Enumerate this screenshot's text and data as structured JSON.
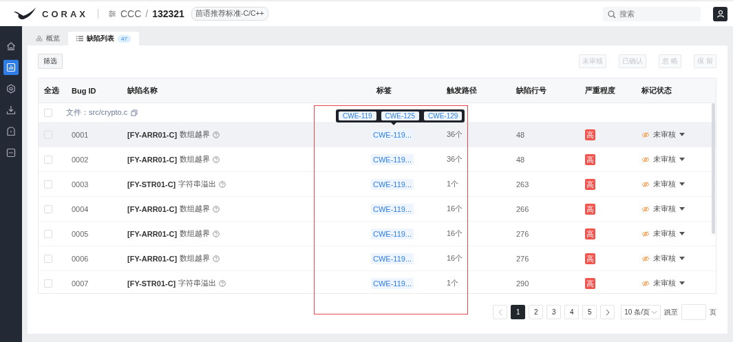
{
  "header": {
    "logo": "CORAX",
    "project": "CCC",
    "separator": "/",
    "id": "132321",
    "standard": "茴语推荐标准-C/C++",
    "search": {
      "placeholder": "搜索"
    }
  },
  "sidebar": {
    "items": [
      {
        "kind": "home",
        "selected": false
      },
      {
        "kind": "chart",
        "selected": true
      },
      {
        "kind": "target",
        "selected": false
      },
      {
        "kind": "download",
        "selected": false
      },
      {
        "kind": "shield",
        "selected": false
      },
      {
        "kind": "bug",
        "selected": false
      }
    ]
  },
  "tabs": [
    {
      "label": "概览",
      "selected": false
    },
    {
      "label": "缺陷列表",
      "count": "47",
      "selected": true
    }
  ],
  "filter_button": "筛选",
  "actions": [
    {
      "label": "未审核",
      "disabled": true
    },
    {
      "label": "已确认",
      "disabled": true
    },
    {
      "label": "忽 略",
      "disabled": true
    },
    {
      "label": "保 留",
      "disabled": true
    }
  ],
  "table": {
    "columns": [
      "全选",
      "Bug ID",
      "缺陷名称",
      "标签",
      "触发路径",
      "缺陷行号",
      "严重程度",
      "标记状态"
    ],
    "file_group": {
      "label": "文件：src/crypto.c",
      "checked": false
    },
    "rows": [
      {
        "id": "0001",
        "rule": "[FY-ARR01-C]",
        "name": "数组越界",
        "tag": "CWE-119...",
        "paths": "36个",
        "line": "48",
        "severity": "高",
        "status": "未审核",
        "checked": false,
        "highlighted": true
      },
      {
        "id": "0002",
        "rule": "[FY-ARR01-C]",
        "name": "数组越界",
        "tag": "CWE-119...",
        "paths": "36个",
        "line": "48",
        "severity": "高",
        "status": "未审核",
        "checked": false,
        "highlighted": false
      },
      {
        "id": "0003",
        "rule": "[FY-STR01-C]",
        "name": "字符串溢出",
        "tag": "CWE-119...",
        "paths": "1个",
        "line": "263",
        "severity": "高",
        "status": "未审核",
        "checked": false,
        "highlighted": false
      },
      {
        "id": "0004",
        "rule": "[FY-ARR01-C]",
        "name": "数组越界",
        "tag": "CWE-119...",
        "paths": "16个",
        "line": "266",
        "severity": "高",
        "status": "未审核",
        "checked": false,
        "highlighted": false
      },
      {
        "id": "0005",
        "rule": "[FY-ARR01-C]",
        "name": "数组越界",
        "tag": "CWE-119...",
        "paths": "16个",
        "line": "276",
        "severity": "高",
        "status": "未审核",
        "checked": false,
        "highlighted": false
      },
      {
        "id": "0006",
        "rule": "[FY-ARR01-C]",
        "name": "数组越界",
        "tag": "CWE-119...",
        "paths": "16个",
        "line": "276",
        "severity": "高",
        "status": "未审核",
        "checked": false,
        "highlighted": false
      },
      {
        "id": "0007",
        "rule": "[FY-STR01-C]",
        "name": "字符串溢出",
        "tag": "CWE-119...",
        "paths": "1个",
        "line": "290",
        "severity": "高",
        "status": "未审核",
        "checked": false,
        "highlighted": false
      }
    ]
  },
  "tooltip": {
    "tags": [
      "CWE-119",
      "CWE-125",
      "CWE-129"
    ]
  },
  "pagination": {
    "pages": [
      {
        "label": "1",
        "selected": true
      },
      {
        "label": "2",
        "selected": false
      },
      {
        "label": "3",
        "selected": false
      },
      {
        "label": "4",
        "selected": false
      },
      {
        "label": "5",
        "selected": false
      }
    ],
    "page_size": "10 条/页",
    "jump_label": "跳至",
    "page_unit": "页"
  }
}
